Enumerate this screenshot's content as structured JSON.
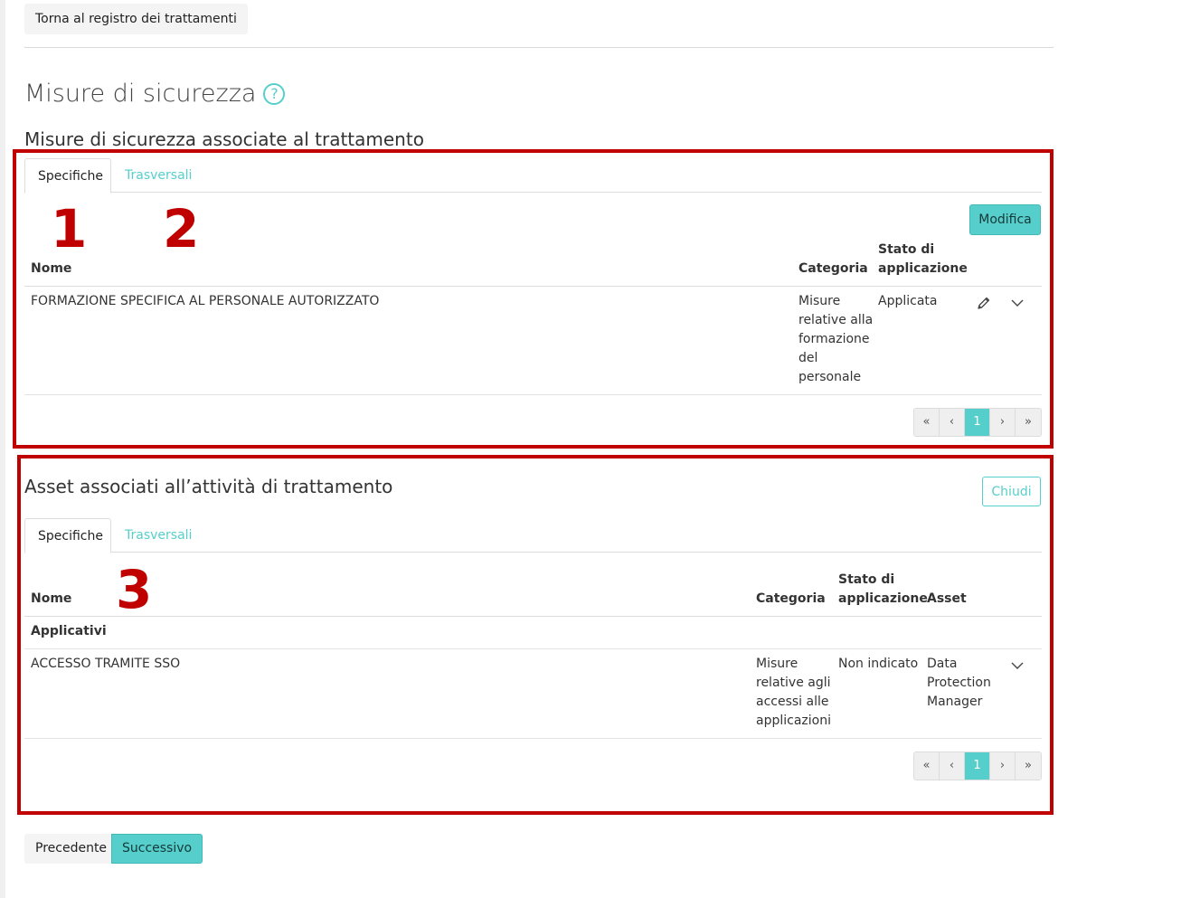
{
  "back_button": "Torna al registro dei trattamenti",
  "page_title": "Misure di sicurezza",
  "help_symbol": "?",
  "section1": {
    "title": "Misure di sicurezza associate al trattamento",
    "tabs": [
      "Specifiche",
      "Trasversali"
    ],
    "annotations": [
      "1",
      "2"
    ],
    "edit_button": "Modifica",
    "columns": {
      "name": "Nome",
      "category": "Categoria",
      "status_line1": "Stato di",
      "status_line2": "applicazione"
    },
    "rows": [
      {
        "name": "FORMAZIONE SPECIFICA AL PERSONALE AUTORIZZATO",
        "category": [
          "Misure",
          "relative alla",
          "formazione",
          "del",
          "personale"
        ],
        "status": "Applicata"
      }
    ],
    "pager": [
      "«",
      "‹",
      "1",
      "›",
      "»"
    ]
  },
  "section2": {
    "title": "Asset associati all’attività di trattamento",
    "close_button": "Chiudi",
    "tabs": [
      "Specifiche",
      "Trasversali"
    ],
    "annotation": "3",
    "columns": {
      "name": "Nome",
      "category": "Categoria",
      "status_line1": "Stato di",
      "status_line2": "applicazione",
      "asset": "Asset"
    },
    "group": "Applicativi",
    "rows": [
      {
        "name": "ACCESSO TRAMITE SSO",
        "category": [
          "Misure",
          "relative agli",
          "accessi alle",
          "applicazioni"
        ],
        "status": "Non indicato",
        "asset": [
          "Data",
          "Protection",
          "Manager"
        ]
      }
    ],
    "pager": [
      "«",
      "‹",
      "1",
      "›",
      "»"
    ]
  },
  "footer": {
    "prev": "Precedente",
    "next": "Successivo"
  },
  "colors": {
    "accent": "#56cfcc",
    "annotation": "#c00000"
  },
  "icons": [
    "help-icon",
    "pencil-icon",
    "chevron-down-icon"
  ]
}
